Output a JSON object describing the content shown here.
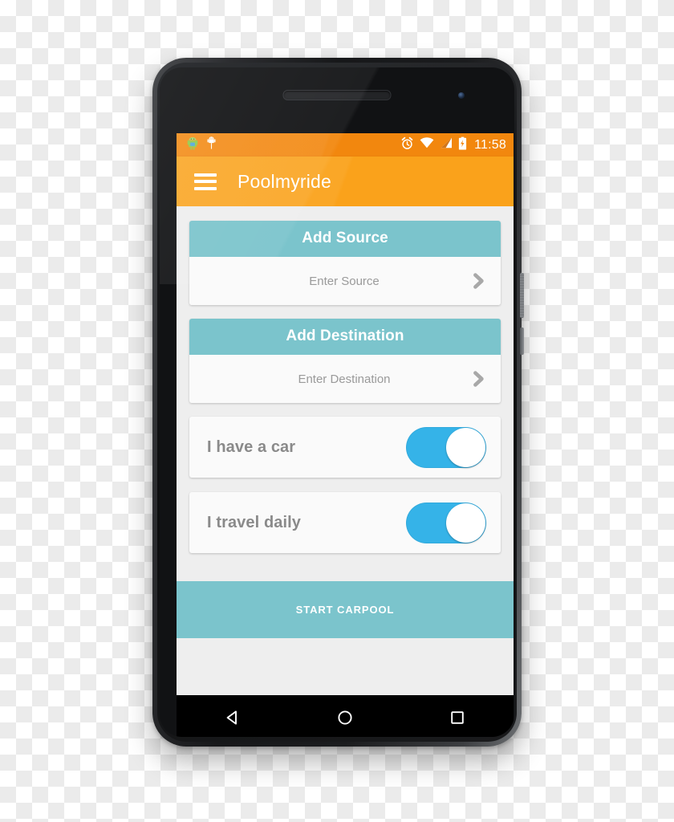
{
  "status_bar": {
    "time": "11:58",
    "icons_left": [
      "android-mascot-icon",
      "android-notification-icon"
    ],
    "icons_right": [
      "alarm-icon",
      "wifi-icon",
      "cellular-signal-icon",
      "battery-charging-icon"
    ],
    "background_color": "#f2870e"
  },
  "app_bar": {
    "title": "Poolmyride",
    "menu_icon": "hamburger-menu-icon",
    "background_color": "#faa21b",
    "text_color": "#ffffff"
  },
  "groups": [
    {
      "header": "Add Source",
      "field_placeholder": "Enter Source",
      "field_value": "",
      "chevron_icon": "chevron-right-icon"
    },
    {
      "header": "Add Destination",
      "field_placeholder": "Enter Destination",
      "field_value": "",
      "chevron_icon": "chevron-right-icon"
    }
  ],
  "toggles": [
    {
      "label": "I have a car",
      "state": "on"
    },
    {
      "label": "I travel daily",
      "state": "on"
    }
  ],
  "primary_button": {
    "label": "START CARPOOL",
    "background_color": "#7bc4cc"
  },
  "nav_bar": {
    "back_icon": "back-triangle-icon",
    "home_icon": "home-circle-icon",
    "recents_icon": "recents-square-icon"
  },
  "theme": {
    "teal": "#7bc4cc",
    "orange": "#faa21b",
    "orange_dark": "#f2870e",
    "toggle_blue": "#35b3e8",
    "content_background": "#eeeeee",
    "card_background": "#fafafa",
    "placeholder_text": "#9a9a9a",
    "label_text": "#8a8a8a"
  }
}
